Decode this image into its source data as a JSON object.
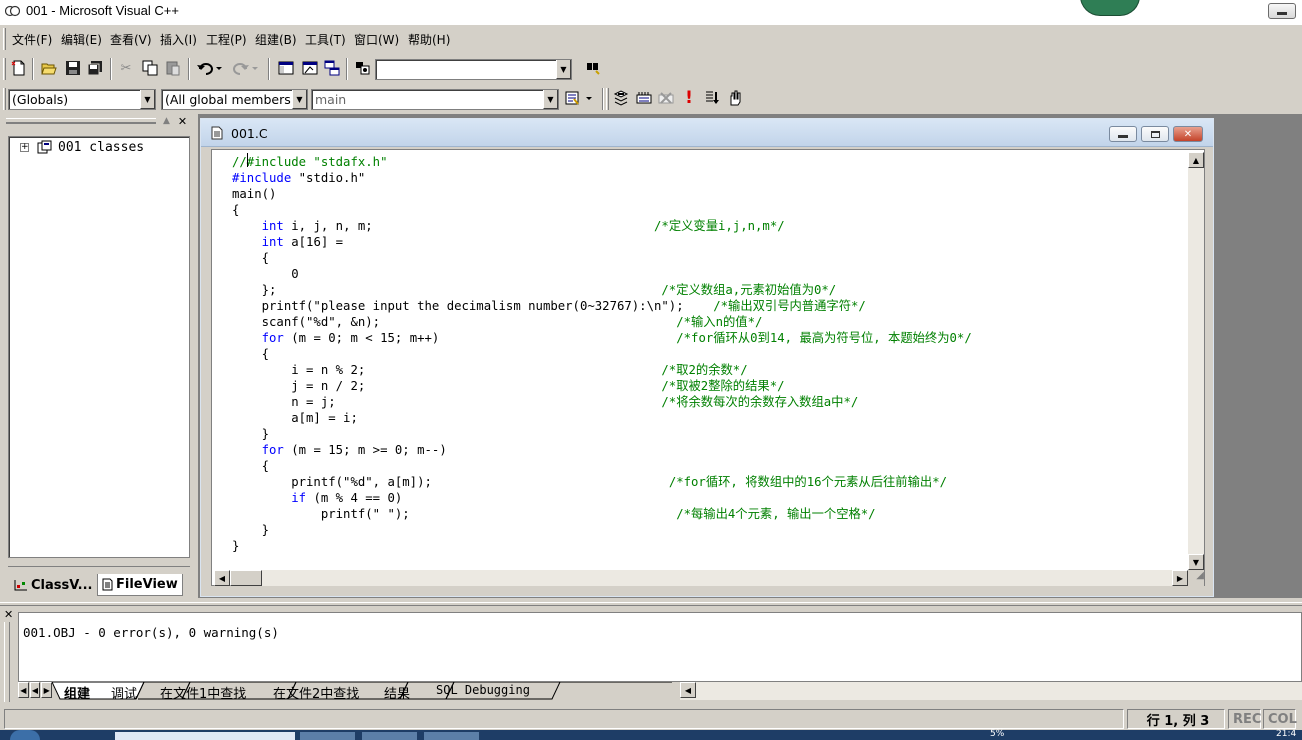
{
  "window": {
    "title": "001 - Microsoft Visual C++"
  },
  "menu": [
    {
      "label": "文件(F)"
    },
    {
      "label": "编辑(E)"
    },
    {
      "label": "查看(V)"
    },
    {
      "label": "插入(I)"
    },
    {
      "label": "工程(P)"
    },
    {
      "label": "组建(B)"
    },
    {
      "label": "工具(T)"
    },
    {
      "label": "窗口(W)"
    },
    {
      "label": "帮助(H)"
    }
  ],
  "toolbar": {
    "find_combo_value": ""
  },
  "wizardbar": {
    "class_combo": "(Globals)",
    "filter_combo": "(All global members",
    "member_combo": "main"
  },
  "workspace": {
    "tree_root": "001 classes",
    "tabs": [
      {
        "label": "ClassV..."
      },
      {
        "label": "FileView"
      }
    ]
  },
  "editor": {
    "title": "001.C",
    "lines": [
      {
        "segs": [
          {
            "t": "//#include \"stdafx.h\"",
            "c": "cm"
          }
        ]
      },
      {
        "segs": [
          {
            "t": "#include",
            "c": "pp"
          },
          {
            "t": " \"stdio.h\"",
            "c": ""
          }
        ]
      },
      {
        "segs": [
          {
            "t": "main()",
            "c": ""
          }
        ]
      },
      {
        "segs": [
          {
            "t": "{",
            "c": ""
          }
        ]
      },
      {
        "segs": [
          {
            "t": "    ",
            "c": ""
          },
          {
            "t": "int",
            "c": "kw"
          },
          {
            "t": " i, j, n, m;                                      ",
            "c": ""
          },
          {
            "t": "/*定义变量i,j,n,m*/",
            "c": "cm"
          }
        ]
      },
      {
        "segs": [
          {
            "t": "    ",
            "c": ""
          },
          {
            "t": "int",
            "c": "kw"
          },
          {
            "t": " a[16] =",
            "c": ""
          }
        ]
      },
      {
        "segs": [
          {
            "t": "    {",
            "c": ""
          }
        ]
      },
      {
        "segs": [
          {
            "t": "        0",
            "c": ""
          }
        ]
      },
      {
        "segs": [
          {
            "t": "    };                                                    ",
            "c": ""
          },
          {
            "t": "/*定义数组a,元素初始值为0*/",
            "c": "cm"
          }
        ]
      },
      {
        "segs": [
          {
            "t": "    printf(\"please input the decimalism number(0~32767):\\n\");    ",
            "c": ""
          },
          {
            "t": "/*输出双引号内普通字符*/",
            "c": "cm"
          }
        ]
      },
      {
        "segs": [
          {
            "t": "    scanf(\"%d\", &n);                                        ",
            "c": ""
          },
          {
            "t": "/*输入n的值*/",
            "c": "cm"
          }
        ]
      },
      {
        "segs": [
          {
            "t": "    ",
            "c": ""
          },
          {
            "t": "for",
            "c": "kw"
          },
          {
            "t": " (m = 0; m < 15; m++)                                ",
            "c": ""
          },
          {
            "t": "/*for循环从0到14, 最高为符号位, 本题始终为0*/",
            "c": "cm"
          }
        ]
      },
      {
        "segs": [
          {
            "t": "    {",
            "c": ""
          }
        ]
      },
      {
        "segs": [
          {
            "t": "        i = n % 2;                                        ",
            "c": ""
          },
          {
            "t": "/*取2的余数*/",
            "c": "cm"
          }
        ]
      },
      {
        "segs": [
          {
            "t": "        j = n / 2;                                        ",
            "c": ""
          },
          {
            "t": "/*取被2整除的结果*/",
            "c": "cm"
          }
        ]
      },
      {
        "segs": [
          {
            "t": "        n = j;                                            ",
            "c": ""
          },
          {
            "t": "/*将余数每次的余数存入数组a中*/",
            "c": "cm"
          }
        ]
      },
      {
        "segs": [
          {
            "t": "        a[m] = i;",
            "c": ""
          }
        ]
      },
      {
        "segs": [
          {
            "t": "    }",
            "c": ""
          }
        ]
      },
      {
        "segs": [
          {
            "t": "    ",
            "c": ""
          },
          {
            "t": "for",
            "c": "kw"
          },
          {
            "t": " (m = 15; m >= 0; m--)",
            "c": ""
          }
        ]
      },
      {
        "segs": [
          {
            "t": "    {",
            "c": ""
          }
        ]
      },
      {
        "segs": [
          {
            "t": "        printf(\"%d\", a[m]);                                ",
            "c": ""
          },
          {
            "t": "/*for循环, 将数组中的16个元素从后往前输出*/",
            "c": "cm"
          }
        ]
      },
      {
        "segs": [
          {
            "t": "        ",
            "c": ""
          },
          {
            "t": "if",
            "c": "kw"
          },
          {
            "t": " (m % 4 == 0)",
            "c": ""
          }
        ]
      },
      {
        "segs": [
          {
            "t": "            printf(\" \");                                    ",
            "c": ""
          },
          {
            "t": "/*每输出4个元素, 输出一个空格*/",
            "c": "cm"
          }
        ]
      },
      {
        "segs": [
          {
            "t": "    }",
            "c": ""
          }
        ]
      },
      {
        "segs": [
          {
            "t": "}",
            "c": ""
          }
        ]
      }
    ]
  },
  "output": {
    "text": "001.OBJ - 0 error(s), 0 warning(s)",
    "tabs": [
      {
        "label": "组建"
      },
      {
        "label": "调试"
      },
      {
        "label": "在文件1中查找"
      },
      {
        "label": "在文件2中查找"
      },
      {
        "label": "结果"
      },
      {
        "label": "SQL Debugging"
      }
    ]
  },
  "status": {
    "position": "行 1, 列 3",
    "rec": "REC",
    "col": "COL",
    "taskbar_cpu": "5%",
    "taskbar_clock": "21:4"
  },
  "icons": [
    "app-icon",
    "new-file-icon",
    "open-folder-icon",
    "save-icon",
    "save-all-icon",
    "cut-icon",
    "copy-icon",
    "paste-icon",
    "undo-icon",
    "redo-icon",
    "workspace-icon",
    "output-icon",
    "windows-icon",
    "find-in-files-icon",
    "find-icon",
    "compile-icon",
    "build-icon",
    "stop-build-icon",
    "execute-icon",
    "go-icon",
    "breakpoint-icon",
    "wizard-action-icon",
    "classes-icon"
  ]
}
